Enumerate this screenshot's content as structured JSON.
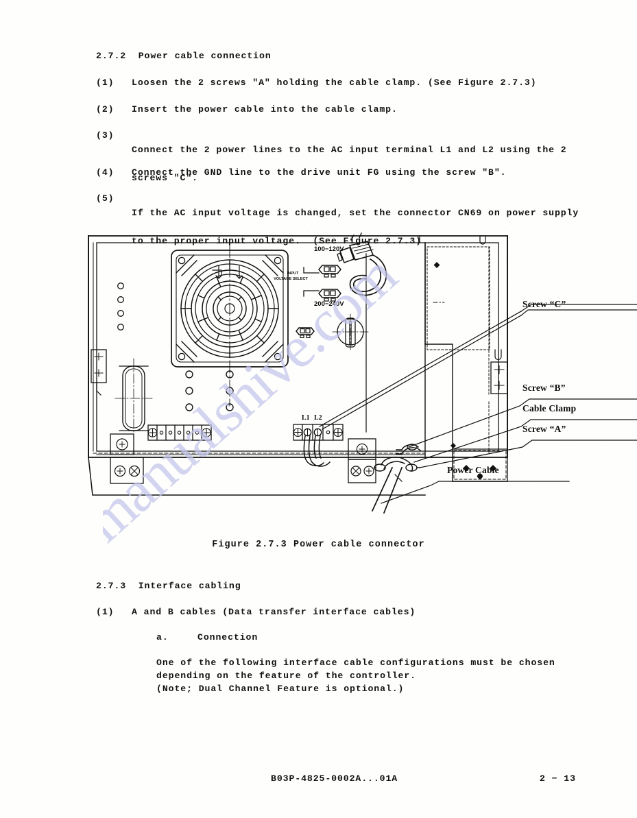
{
  "section_2_7_2": {
    "heading": "2.7.2  Power cable connection",
    "steps": [
      {
        "marker": "(1)",
        "lines": [
          "Loosen the 2 screws \"A\" holding the cable clamp.  (See Figure 2.7.3)"
        ]
      },
      {
        "marker": "(2)",
        "lines": [
          "Insert the power cable into the cable clamp."
        ]
      },
      {
        "marker": "(3)",
        "lines": [
          "Connect the 2 power lines to the AC input terminal L1 and L2 using the 2",
          "screws \"C\"."
        ]
      },
      {
        "marker": "(4)",
        "lines": [
          "Connect the GND line to the drive unit FG using the screw \"B\"."
        ]
      },
      {
        "marker": "(5)",
        "lines": [
          "If the AC input voltage is changed, set the connector CN69 on power supply",
          "to the proper input voltage.  (See Figure 2.7.3)"
        ]
      }
    ]
  },
  "figure": {
    "caption": "Figure 2.7.3  Power cable connector",
    "drawing_labels": {
      "voltage_high": "100−120V",
      "voltage_low": "200−240V",
      "input_select_line1": "INPUT",
      "input_select_line2": "VOLTAGE SELECT",
      "terminal_l1": "L1",
      "terminal_l2": "L2"
    },
    "callouts": [
      {
        "label": "Screw “C”"
      },
      {
        "label": "Screw “B”"
      },
      {
        "label": "Cable Clamp"
      },
      {
        "label": "Screw “A”"
      },
      {
        "label": "Power Cable"
      }
    ]
  },
  "section_2_7_3": {
    "heading": "2.7.3  Interface cabling",
    "item_marker": "(1)",
    "item_text": "A and B cables (Data transfer interface cables)",
    "sub_marker": "a.",
    "sub_text": "Connection",
    "paragraph": [
      "One of the following interface cable configurations must be chosen",
      "depending on the feature of the controller.",
      "(Note; Dual Channel Feature is optional.)"
    ]
  },
  "footer": {
    "document_number": "B03P-4825-0002A...01A",
    "page_number": "2 − 13"
  },
  "watermark": {
    "text": "manualshive.com"
  },
  "colors": {
    "ink": "#111111",
    "paper": "#fefefd",
    "watermark": "#c3c6ec"
  }
}
